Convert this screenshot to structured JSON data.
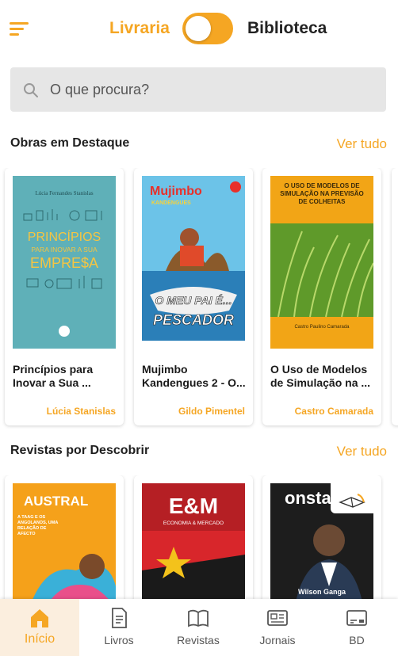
{
  "header": {
    "left_mode": "Livraria",
    "right_mode": "Biblioteca"
  },
  "search": {
    "placeholder": "O que procura?"
  },
  "sections": {
    "featured": {
      "title": "Obras em Destaque",
      "see_all": "Ver tudo",
      "items": [
        {
          "title": "Princípios para Inovar a Sua ...",
          "author": "Lúcia Stanislas",
          "cover_author": "Lúcia Fernandes Stanislas",
          "cover_title_1": "PRINCÍPIOS",
          "cover_title_2": "PARA INOVAR A SUA",
          "cover_title_3": "EMPRE$A"
        },
        {
          "title": "Mujimbo Kandengues 2 - O...",
          "author": "Gildo Pimentel",
          "cover_logo": "Mujimbo",
          "cover_sub": "KANDENGUES",
          "cover_title_1": "O MEU PAI É...",
          "cover_title_2": "PESCADOR"
        },
        {
          "title": "O Uso de Modelos de Simulação na ...",
          "author": "Castro Camarada",
          "cover_title": "O USO DE MODELOS DE SIMULAÇÃO NA PREVISÃO DE COLHEITAS",
          "cover_author": "Castro Paulino Camarada"
        }
      ]
    },
    "magazines": {
      "title": "Revistas por Descobrir",
      "see_all": "Ver tudo",
      "items": [
        {
          "cover_title": "AUSTRAL",
          "cover_text": "A TAAG E OS ANGOLANOS, UMA RELAÇÃO DE AFECTO"
        },
        {
          "cover_title": "E&M",
          "cover_sub": "ECONOMIA & MERCADO"
        },
        {
          "cover_title": "onstar",
          "cover_name": "Wilson Ganga"
        }
      ]
    }
  },
  "nav": {
    "items": [
      {
        "label": "Início",
        "icon": "home-icon"
      },
      {
        "label": "Livros",
        "icon": "book-document-icon"
      },
      {
        "label": "Revistas",
        "icon": "open-book-icon"
      },
      {
        "label": "Jornais",
        "icon": "newspaper-icon"
      },
      {
        "label": "BD",
        "icon": "comic-card-icon"
      }
    ]
  },
  "colors": {
    "accent": "#f5a623",
    "search_bg": "#e6e6e6"
  }
}
